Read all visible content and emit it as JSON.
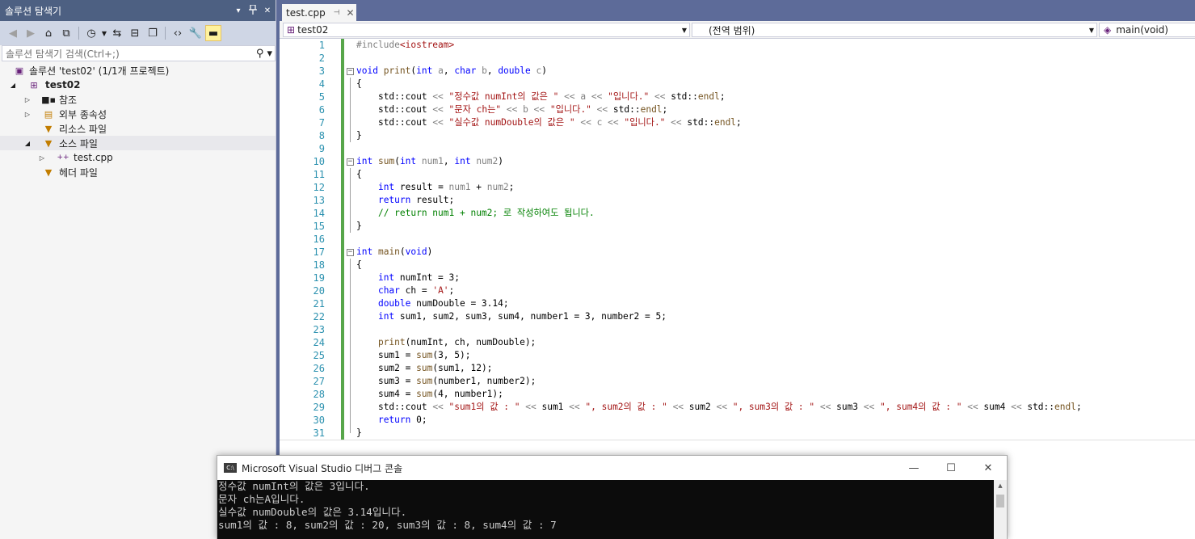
{
  "solution_explorer": {
    "title": "솔루션 탐색기",
    "title_buttons": [
      "▾",
      "ㅁ",
      "✕"
    ],
    "search_placeholder": "솔루션 탐색기 검색(Ctrl+;)",
    "tree": [
      {
        "label": "솔루션 'test02' (1/1개 프로젝트)",
        "icon": "solution-icon"
      },
      {
        "label": "test02",
        "icon": "project-icon",
        "expanded": true
      },
      {
        "label": "참조",
        "icon": "references-icon",
        "expanded": false
      },
      {
        "label": "외부 종속성",
        "icon": "external-deps-icon",
        "expanded": false
      },
      {
        "label": "리소스 파일",
        "icon": "filter-folder-icon"
      },
      {
        "label": "소스 파일",
        "icon": "filter-folder-icon",
        "expanded": true,
        "selected": true
      },
      {
        "label": "test.cpp",
        "icon": "cpp-file-icon",
        "expanded": false
      },
      {
        "label": "헤더 파일",
        "icon": "filter-folder-icon"
      }
    ]
  },
  "editor": {
    "tab_label": "test.cpp",
    "nav_project": "test02",
    "nav_scope": "(전역 범위)",
    "nav_member": "main(void)",
    "line_numbers": [
      "1",
      "2",
      "3",
      "4",
      "5",
      "6",
      "7",
      "8",
      "9",
      "10",
      "11",
      "12",
      "13",
      "14",
      "15",
      "16",
      "17",
      "18",
      "19",
      "20",
      "21",
      "22",
      "23",
      "24",
      "25",
      "26",
      "27",
      "28",
      "29",
      "30",
      "31"
    ],
    "code": {
      "l1_pp": "#include",
      "l1_inc": "<iostream>",
      "l3_kw": "void",
      "l3_fn": "print",
      "l3_a": "(",
      "l3_k1": "int",
      "l3_p1": "a",
      "l3_b": ",",
      "l3_k2": "char",
      "l3_p2": "b",
      "l3_c": ",",
      "l3_k3": "double",
      "l3_p3": "c",
      "l3_d": ")",
      "open_brace": "{",
      "close_brace": "}",
      "l5_a": "std::cout ",
      "l5_op1": "<<",
      "l5_s1": "\"정수값 numInt의 값은 \"",
      "l5_op2": "<<",
      "l5_v": "a",
      "l5_op3": "<<",
      "l5_s2": "\"입니다.\"",
      "l5_op4": "<<",
      "l5_e": "std::",
      "l5_endl": "endl",
      "l6_s1": "\"문자 ch는\"",
      "l6_v": "b",
      "l7_s1": "\"실수값 numDouble의 값은 \"",
      "l7_v": "c",
      "l10_kw": "int",
      "l10_fn": "sum",
      "l10_p1": "num1",
      "l10_p2": "num2",
      "l12_kw": "int",
      "l12_rest": "result = ",
      "l12_p1": "num1",
      "l12_plus": " + ",
      "l12_p2": "num2",
      "l12_end": ";",
      "l13_kw": "return",
      "l13_rest": " result;",
      "l14_cm": "// return num1 + num2; 로 작성하여도 됩니다.",
      "l17_kw": "int",
      "l17_fn": "main",
      "l17_kw2": "void",
      "l19_kw": "int",
      "l19_rest": " numInt = 3;",
      "l20_kw": "char",
      "l20_rest": " ch = ",
      "l20_str": "'A'",
      "l20_end": ";",
      "l21_kw": "double",
      "l21_rest": " numDouble = 3.14;",
      "l22_kw": "int",
      "l22_rest": " sum1, sum2, sum3, sum4, number1 = 3, number2 = 5;",
      "l24_fn": "print",
      "l24_rest": "(numInt, ch, numDouble);",
      "l25_a": "sum1 = ",
      "l25_fn": "sum",
      "l25_rest": "(3, 5);",
      "l26_a": "sum2 = ",
      "l26_rest": "(sum1, 12);",
      "l27_a": "sum3 = ",
      "l27_rest": "(number1, number2);",
      "l28_a": "sum4 = ",
      "l28_rest": "(4, number1);",
      "l29_s1": "\"sum1의 값 : \"",
      "l29_v1": " sum1 ",
      "l29_s2": "\", sum2의 값 : \"",
      "l29_v2": " sum2 ",
      "l29_s3": "\", sum3의 값 : \"",
      "l29_v3": " sum3 ",
      "l29_s4": "\", sum4의 값 : \"",
      "l29_v4": " sum4 ",
      "l30_kw": "return",
      "l30_rest": " 0;"
    }
  },
  "console": {
    "title": "Microsoft Visual Studio 디버그 콘솔",
    "icon_text": "C:\\",
    "output": [
      "정수값 numInt의 값은 3입니다.",
      "문자 ch는A입니다.",
      "실수값 numDouble의 값은 3.14입니다.",
      "sum1의 값 : 8, sum2의 값 : 20, sum3의 값 : 8, sum4의 값 : 7"
    ]
  },
  "colors": {
    "keyword": "#0000ff",
    "string": "#a31515",
    "comment": "#008000",
    "line_number": "#2b91af",
    "change_bar": "#57a64a",
    "title_bar": "#4d6082"
  }
}
